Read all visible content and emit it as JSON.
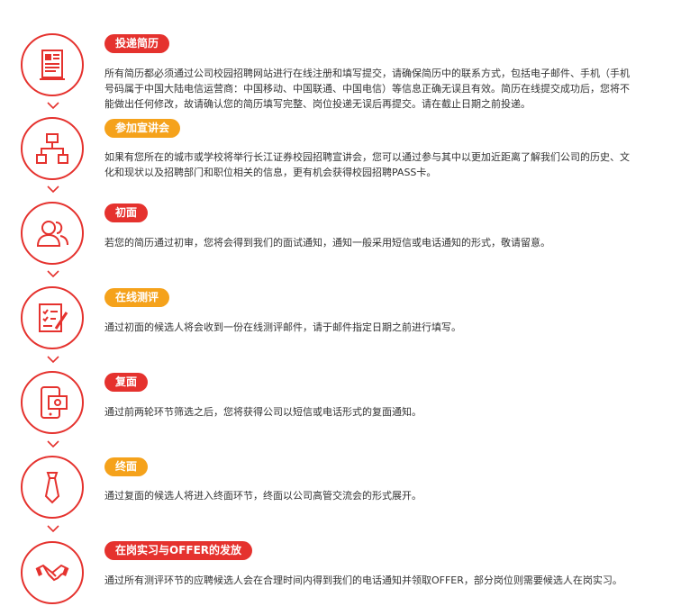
{
  "colors": {
    "red": "#e5322e",
    "orange": "#f5a21b"
  },
  "steps": [
    {
      "icon": "resume-document-icon",
      "badge_color": "red",
      "title": "投递简历",
      "lines": [
        "所有简历都必须通过公司校园招聘网站进行在线注册和填写提交，请确保简历中的联系方式，包括电子邮件、手机（手机",
        "号码属于中国大陆电信运营商：中国移动、中国联通、中国电信）等信息正确无误且有效。简历在线提交成功后，您将不",
        "能做出任何修改，故请确认您的简历填写完整、岗位投递无误后再提交。请在截止日期之前投递。"
      ]
    },
    {
      "icon": "organization-chart-icon",
      "badge_color": "orange",
      "title": "参加宣讲会",
      "lines": [
        "如果有您所在的城市或学校将举行长江证券校园招聘宣讲会，您可以通过参与其中以更加近距离了解我们公司的历史、文",
        "化和现状以及招聘部门和职位相关的信息，更有机会获得校园招聘PASS卡。"
      ]
    },
    {
      "icon": "people-icon",
      "badge_color": "red",
      "title": "初面",
      "lines": [
        "若您的简历通过初审，您将会得到我们的面试通知，通知一般采用短信或电话通知的形式，敬请留意。"
      ]
    },
    {
      "icon": "online-test-icon",
      "badge_color": "orange",
      "title": "在线测评",
      "lines": [
        "通过初面的候选人将会收到一份在线测评邮件，请于邮件指定日期之前进行填写。"
      ]
    },
    {
      "icon": "mobile-message-icon",
      "badge_color": "red",
      "title": "复面",
      "lines": [
        "通过前两轮环节筛选之后，您将获得公司以短信或电话形式的复面通知。"
      ]
    },
    {
      "icon": "necktie-icon",
      "badge_color": "orange",
      "title": "终面",
      "lines": [
        "通过复面的候选人将进入终面环节，终面以公司高管交流会的形式展开。"
      ]
    },
    {
      "icon": "handshake-icon",
      "badge_color": "red",
      "title": "在岗实习与OFFER的发放",
      "lines": [
        "通过所有测评环节的应聘候选人会在合理时间内得到我们的电话通知并领取OFFER，部分岗位则需要候选人在岗实习。"
      ]
    }
  ]
}
